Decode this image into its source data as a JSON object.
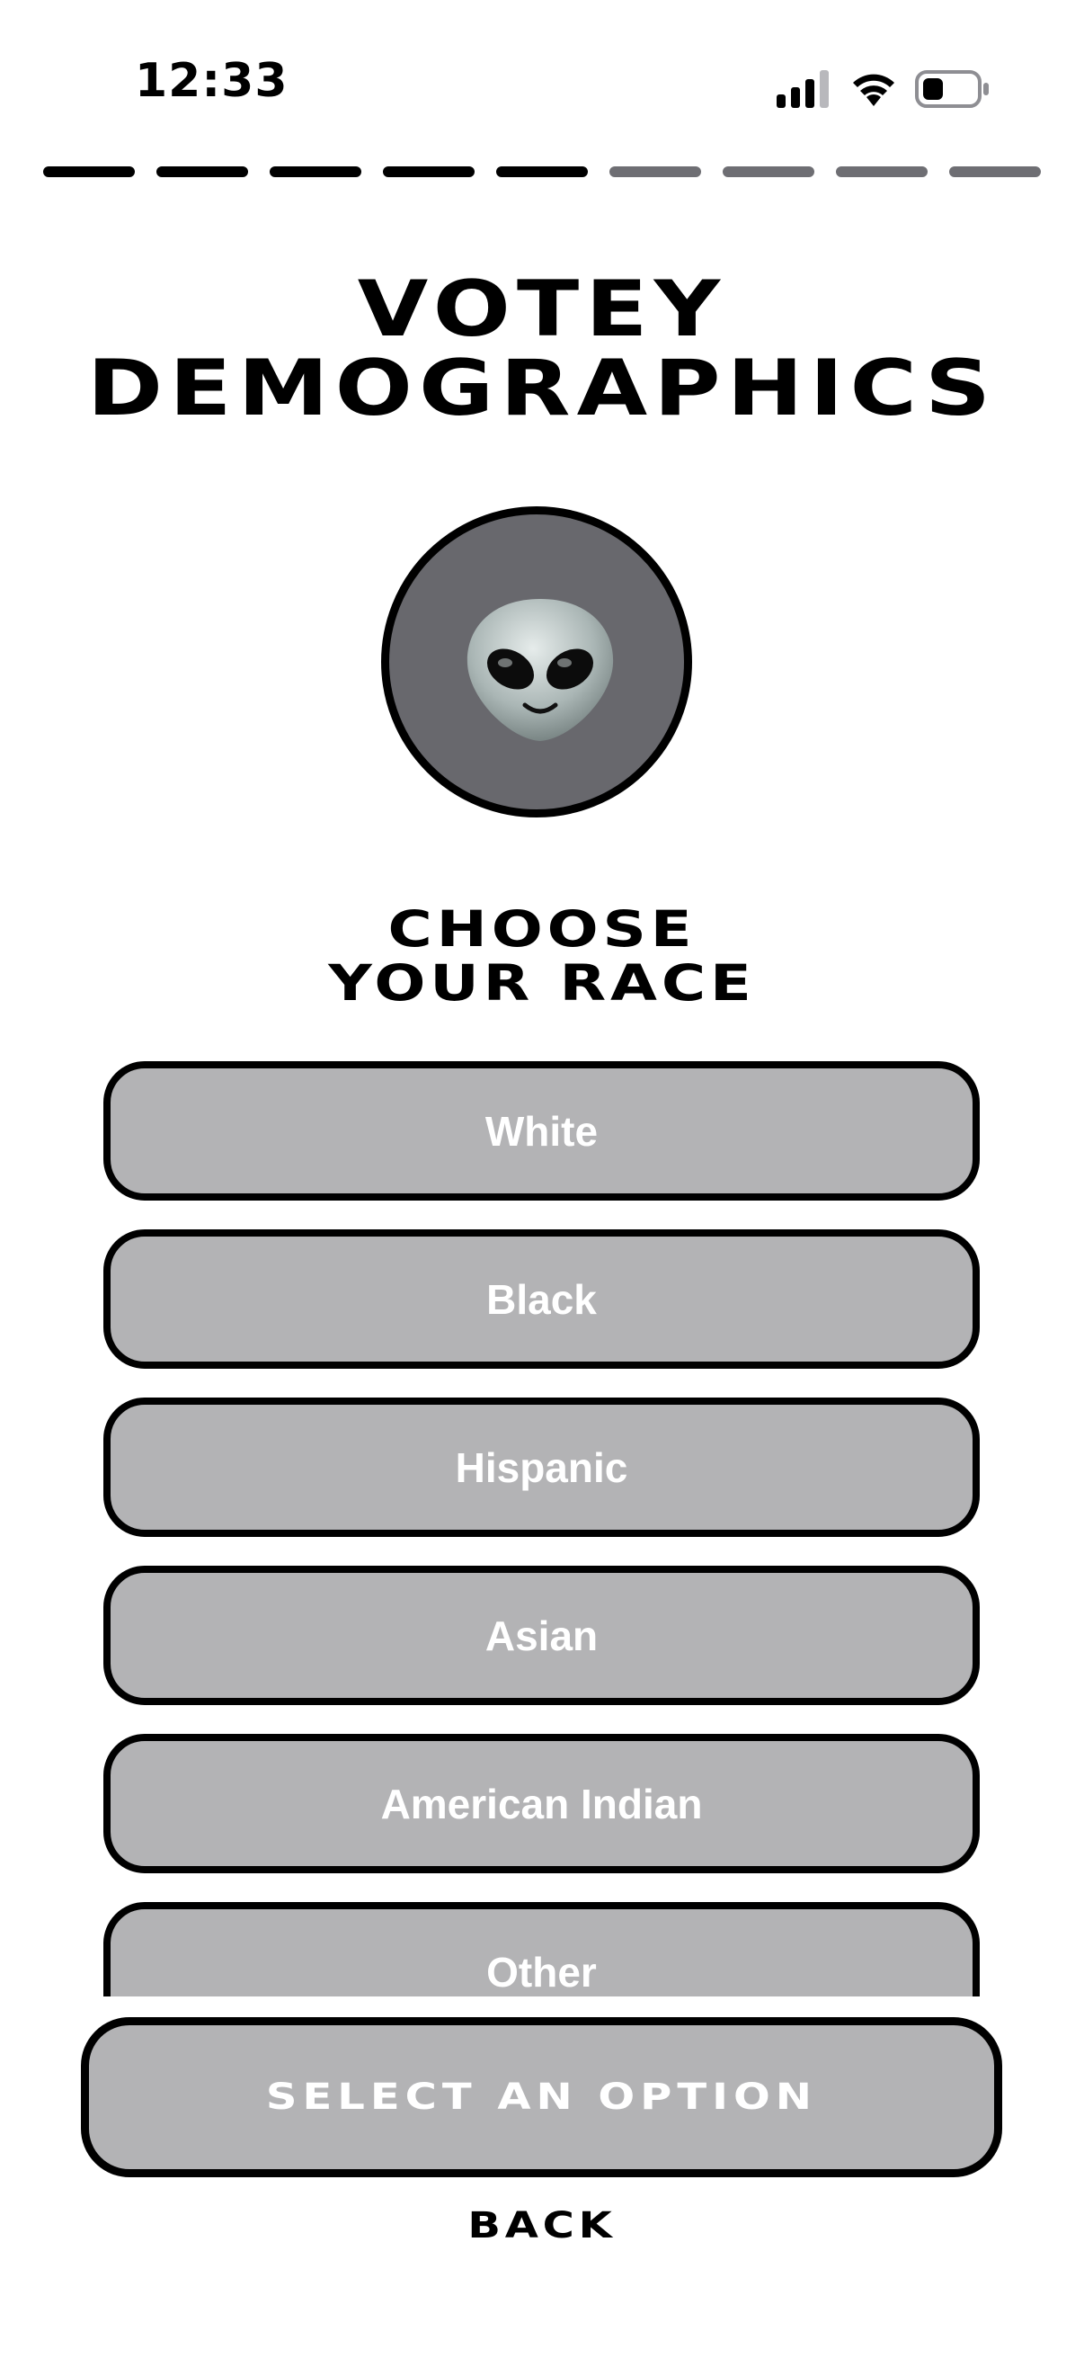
{
  "status_bar": {
    "time": "12:33",
    "icons": [
      "signal-icon",
      "wifi-icon",
      "battery-icon"
    ]
  },
  "progress": {
    "total_steps": 9,
    "completed_steps": 5,
    "done_color": "#000000",
    "pending_color": "#6e6e73"
  },
  "header": {
    "title_line1": "VOTEY",
    "title_line2": "DEMOGRAPHICS"
  },
  "avatar": {
    "icon": "alien-icon",
    "background_color": "#68686d"
  },
  "prompt": {
    "line1": "CHOOSE",
    "line2": "YOUR RACE"
  },
  "options": [
    {
      "label": "White"
    },
    {
      "label": "Black"
    },
    {
      "label": "Hispanic"
    },
    {
      "label": "Asian"
    },
    {
      "label": "American Indian"
    },
    {
      "label": "Other"
    }
  ],
  "actions": {
    "select_label": "SELECT AN OPTION",
    "back_label": "BACK"
  },
  "colors": {
    "button_fill": "#b3b3b5",
    "button_text": "#ffffff",
    "border": "#000000"
  }
}
